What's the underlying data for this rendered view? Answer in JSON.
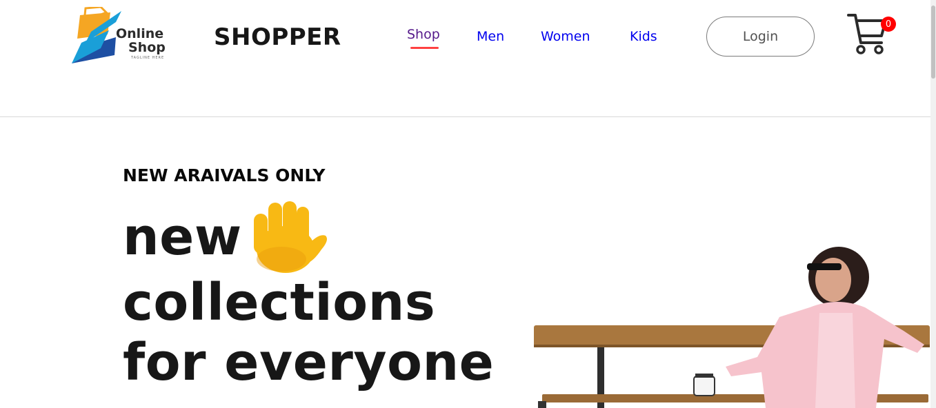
{
  "logo": {
    "line1": "Online",
    "line2": "Shop",
    "tagline": "TAGLINE HERE",
    "colors": {
      "orange": "#f5a623",
      "blue": "#1a9fd8",
      "navy": "#1e4fa3"
    }
  },
  "brand": "SHOPPER",
  "nav": {
    "items": [
      {
        "label": "Shop",
        "active": true
      },
      {
        "label": "Men",
        "active": false
      },
      {
        "label": "Women",
        "active": false
      },
      {
        "label": "Kids",
        "active": false
      }
    ],
    "active_color": "#551a8b",
    "link_color": "#0000ee",
    "underline_color": "#ff4141"
  },
  "login_label": "Login",
  "cart": {
    "count": "0",
    "icon": "cart-icon",
    "badge_color": "#ff0000"
  },
  "hero": {
    "kicker": "NEW ARAIVALS ONLY",
    "line1": "new",
    "line2": "collections",
    "line3": "for everyone",
    "hand_icon": "waving-hand-icon"
  }
}
